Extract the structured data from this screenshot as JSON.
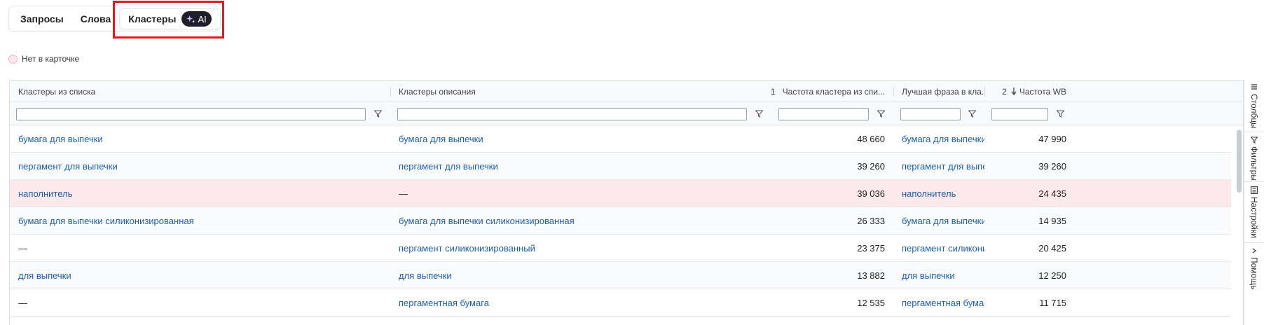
{
  "tabs": [
    {
      "label": "Запросы"
    },
    {
      "label": "Слова"
    },
    {
      "label": "Кластеры",
      "badge": "AI"
    }
  ],
  "legend": {
    "label": "Нет в карточке"
  },
  "columns": [
    {
      "label": "Кластеры из списка"
    },
    {
      "label": "Кластеры описания"
    },
    {
      "sort_order": "1",
      "label": "Частота кластера из спи..."
    },
    {
      "label": "Лучшая фраза в кла..."
    },
    {
      "sort_order": "2",
      "label": "Частота WB"
    }
  ],
  "rows": [
    {
      "list_cluster": "бумага для выпечки",
      "desc_cluster": "бумага для выпечки",
      "freq": "48 660",
      "best_phrase": "бумага для выпечки",
      "wb_freq": "47 990",
      "missing": false
    },
    {
      "list_cluster": "пергамент для выпечки",
      "desc_cluster": "пергамент для выпечки",
      "freq": "39 260",
      "best_phrase": "пергамент для выпеч",
      "wb_freq": "39 260",
      "missing": false
    },
    {
      "list_cluster": "наполнитель",
      "desc_cluster": "—",
      "freq": "39 036",
      "best_phrase": "наполнитель",
      "wb_freq": "24 435",
      "missing": true
    },
    {
      "list_cluster": "бумага для выпечки силиконизированная",
      "desc_cluster": "бумага для выпечки силиконизированная",
      "freq": "26 333",
      "best_phrase": "бумага для выпечки с",
      "wb_freq": "14 935",
      "missing": false
    },
    {
      "list_cluster": "—",
      "desc_cluster": "пергамент силиконизированный",
      "freq": "23 375",
      "best_phrase": "пергамент силикониз",
      "wb_freq": "20 425",
      "missing": false
    },
    {
      "list_cluster": "для выпечки",
      "desc_cluster": "для выпечки",
      "freq": "13 882",
      "best_phrase": "для выпечки",
      "wb_freq": "12 250",
      "missing": false
    },
    {
      "list_cluster": "—",
      "desc_cluster": "пергаментная бумага",
      "freq": "12 535",
      "best_phrase": "пергаментная бумага",
      "wb_freq": "11 715",
      "missing": false
    }
  ],
  "side_panel": [
    {
      "label": "Столбцы",
      "icon": "columns-icon"
    },
    {
      "label": "Фильтры",
      "icon": "filter-icon"
    },
    {
      "label": "Настройки",
      "icon": "settings-icon"
    },
    {
      "label": "Помощь",
      "icon": "chevron-icon"
    }
  ],
  "colors": {
    "link": "#1f5fa8",
    "missing_row_bg": "#fde8eb",
    "highlight_border": "#d6201f",
    "ai_badge_bg": "#1f1f2b"
  }
}
